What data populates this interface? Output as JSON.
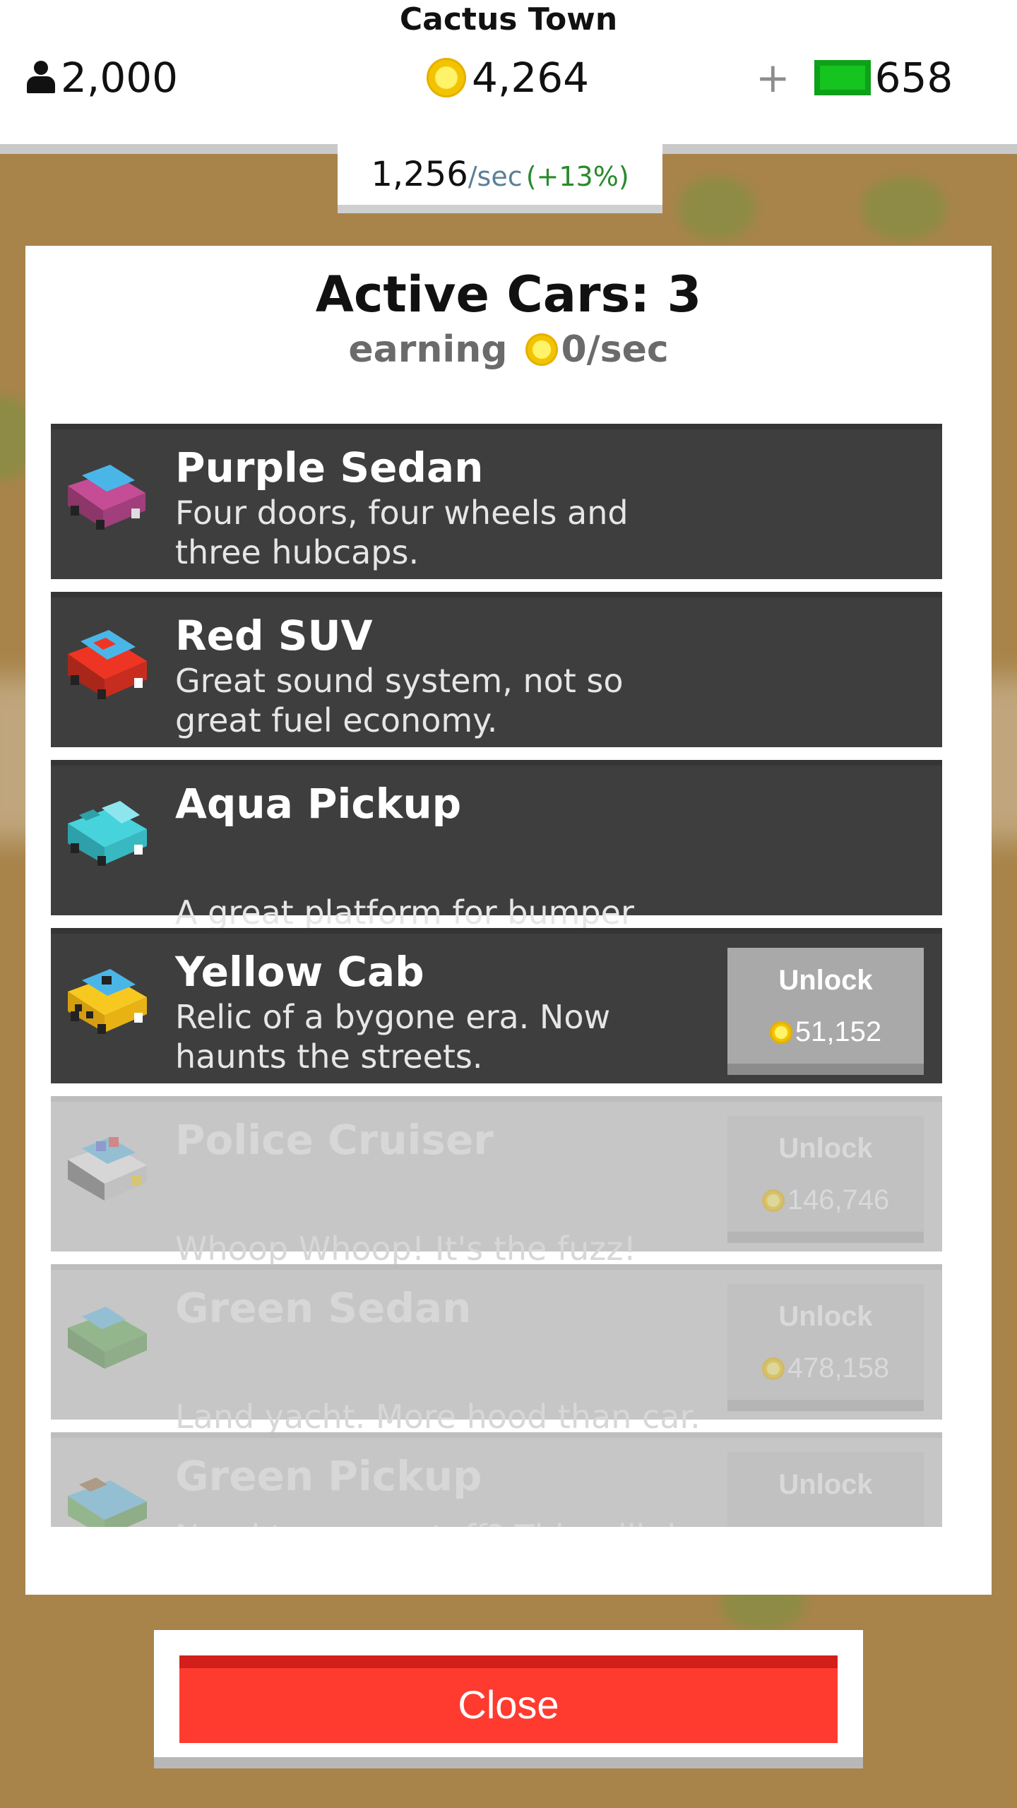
{
  "header": {
    "town_name": "Cactus Town",
    "population": "2,000",
    "coins": "4,264",
    "cash_plus": "+",
    "cash": "658",
    "rate": {
      "value": "1,256",
      "unit": "/sec",
      "bonus": "(+13%)"
    }
  },
  "panel": {
    "title": "Active Cars: 3",
    "earning_label": "earning",
    "earning_rate": "0/sec"
  },
  "cars": [
    {
      "name": "Purple Sedan",
      "description": "Four doors, four wheels and three hubcaps.",
      "state": "active",
      "icon": "purple-sedan-icon"
    },
    {
      "name": "Red SUV",
      "description": "Great sound system, not so great fuel economy.",
      "state": "active",
      "icon": "red-suv-icon"
    },
    {
      "name": "Aqua Pickup",
      "description": "A great platform for bumper stickers.",
      "state": "active",
      "icon": "aqua-pickup-icon"
    },
    {
      "name": "Yellow Cab",
      "description": "Relic of a bygone era. Now haunts the streets.",
      "state": "unlockable",
      "unlock_label": "Unlock",
      "price": "51,152",
      "icon": "yellow-cab-icon"
    },
    {
      "name": "Police Cruiser",
      "description": "Whoop Whoop! It's the fuzz!",
      "state": "locked",
      "unlock_label": "Unlock",
      "price": "146,746",
      "icon": "police-cruiser-icon"
    },
    {
      "name": "Green Sedan",
      "description": "Land yacht. More hood than car.",
      "state": "locked",
      "unlock_label": "Unlock",
      "price": "478,158",
      "icon": "green-sedan-icon"
    },
    {
      "name": "Green Pickup",
      "description": "Need to move stuff? This will do the",
      "state": "locked",
      "unlock_label": "Unlock",
      "icon": "green-pickup-icon"
    }
  ],
  "close_label": "Close",
  "colors": {
    "background": "#a8844a",
    "row_active": "#3e3e3e",
    "row_locked": "#c6c6c6",
    "close": "#ff3b30",
    "coin": "#f2c400",
    "cash": "#15c41f",
    "bonus": "#2a8a2c"
  }
}
